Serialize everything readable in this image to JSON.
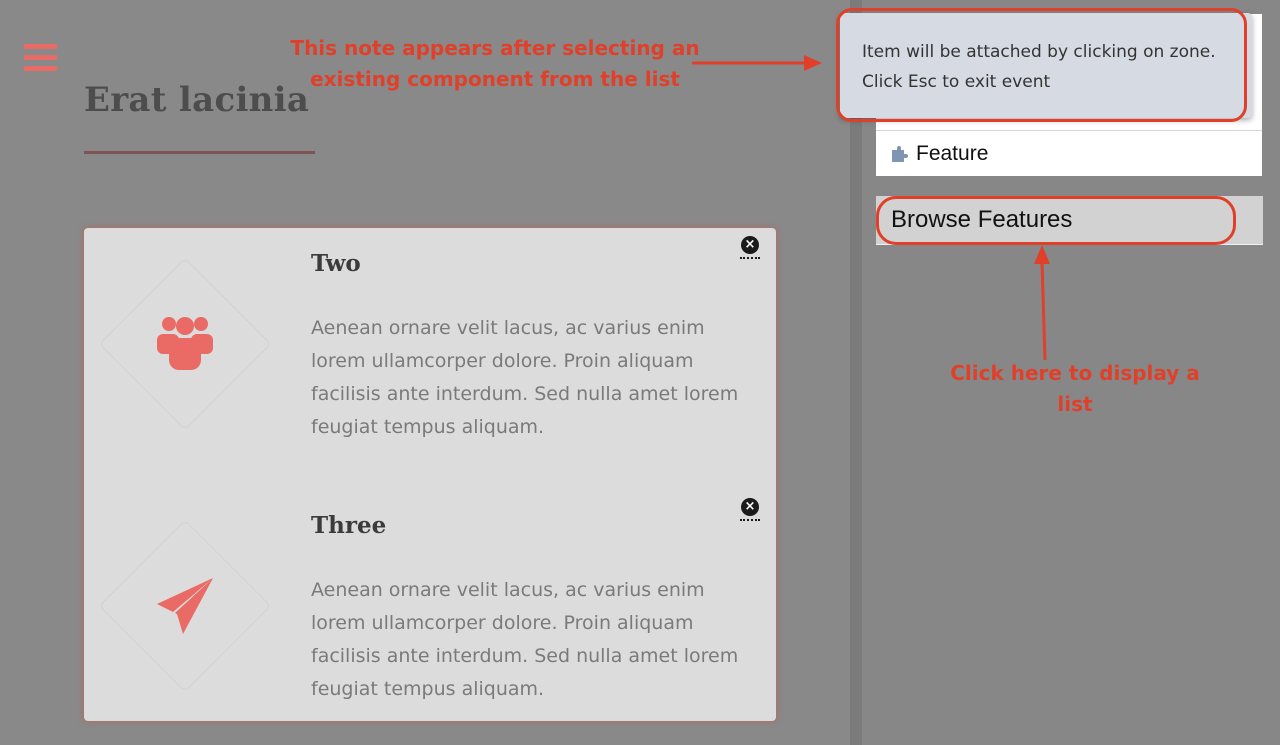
{
  "colors": {
    "accent": "#ea6b65",
    "annotation": "#e0402a",
    "puzzle": "#7f95b3"
  },
  "header": {
    "menu_icon": "hamburger-icon",
    "title": "Erat lacinia"
  },
  "features": [
    {
      "title": "Two",
      "icon": "users-icon",
      "text": "Aenean ornare velit lacus, ac varius enim lorem ullamcorper dolore. Proin aliquam facilisis ante interdum. Sed nulla amet lorem feugiat tempus aliquam.",
      "close_icon": "close-icon",
      "close_symbol": "×"
    },
    {
      "title": "Three",
      "icon": "paper-plane-icon",
      "text": "Aenean ornare velit lacus, ac varius enim lorem ullamcorper dolore. Proin aliquam facilisis ante interdum. Sed nulla amet lorem feugiat tempus aliquam.",
      "close_icon": "close-icon",
      "close_symbol": "×"
    }
  ],
  "sidebar": {
    "note": {
      "line1": "Item will be attached by clicking on zone.",
      "line2": "Click Esc to exit event"
    },
    "list": {
      "feature_item": "Feature",
      "feature_icon": "puzzle-icon"
    },
    "browse_button": "Browse Features"
  },
  "annotations": {
    "note": "This note appears after selecting an existing component from the list",
    "browse": "Click here to display a list"
  }
}
